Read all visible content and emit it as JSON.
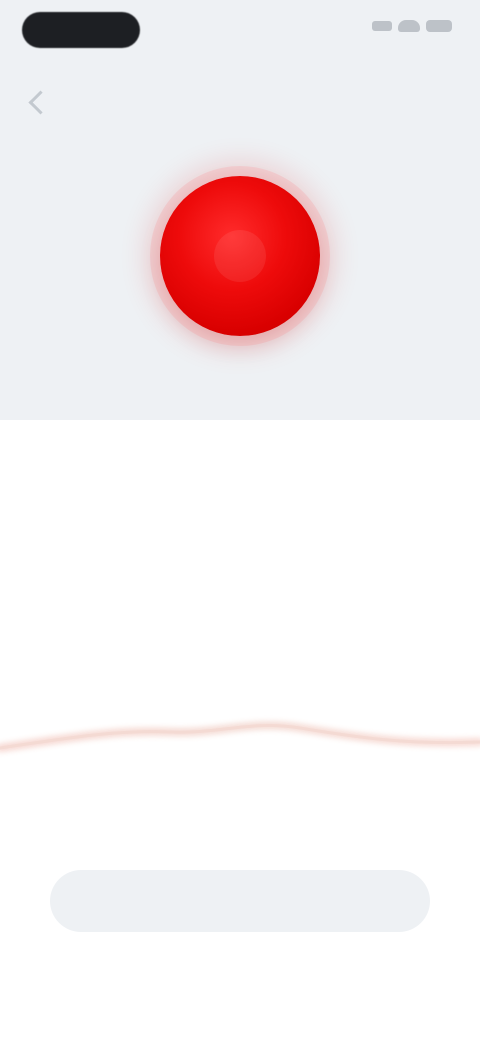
{
  "status_bar": {
    "time": "",
    "icons": [
      "signal-icon",
      "wifi-icon",
      "battery-icon"
    ]
  },
  "header": {
    "back_label": "",
    "title": ""
  },
  "recorder": {
    "caption": "",
    "timer": "",
    "timer_label": ""
  },
  "bottom_action": {
    "label": ""
  },
  "colors": {
    "record": "#E80A0A",
    "top_background": "#EEF1F4",
    "main_background": "#FFFFFF",
    "waveform": "#F7D6CF"
  }
}
